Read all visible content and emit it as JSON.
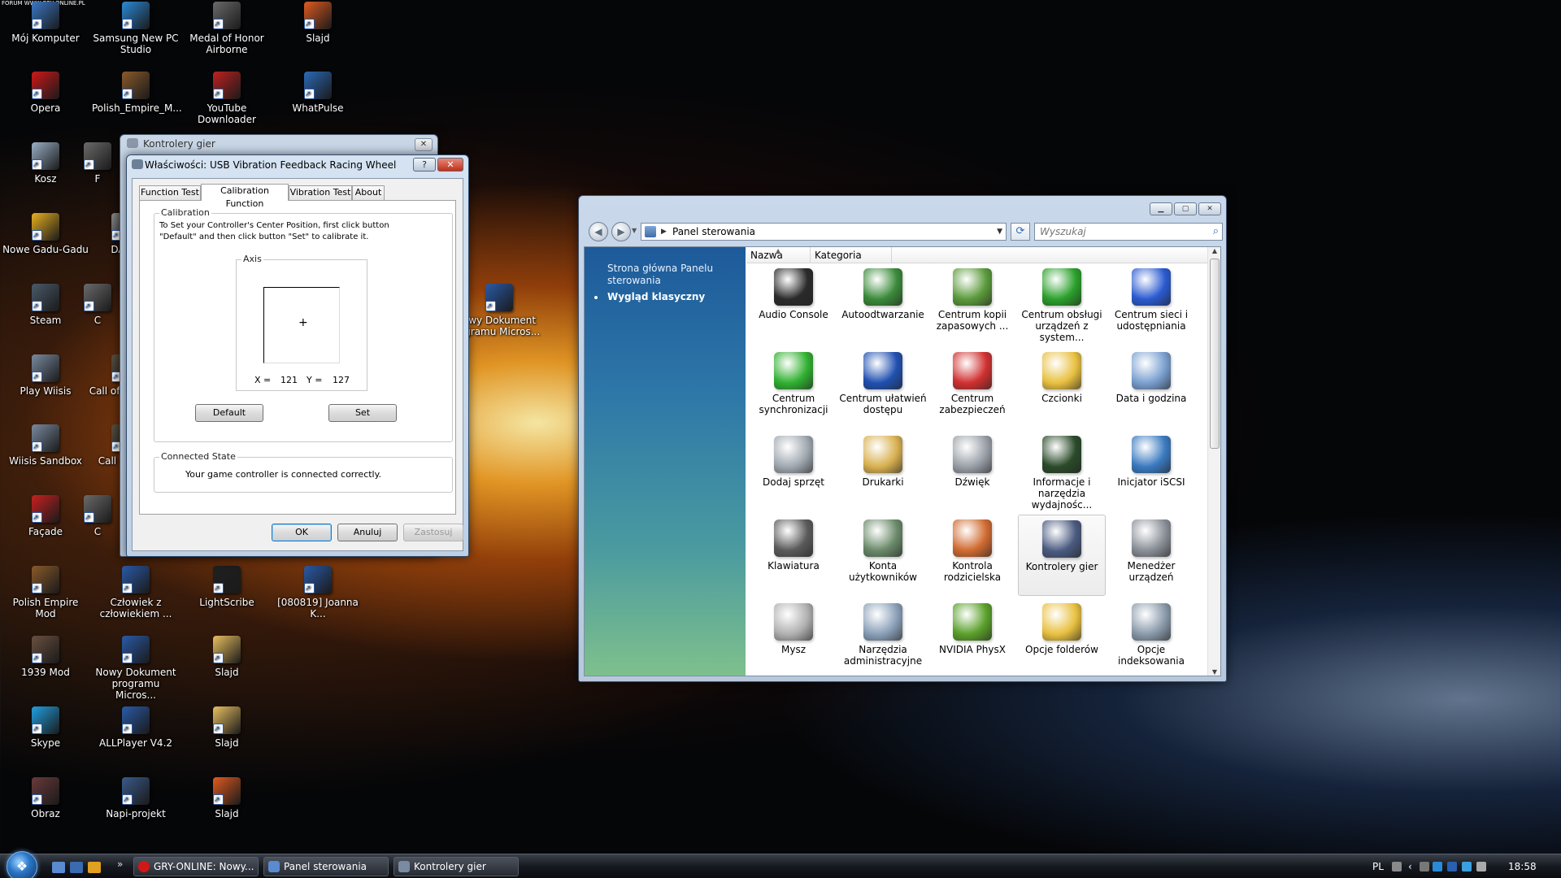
{
  "watermark": "FORUM WWW.GRY-ONLINE.PL",
  "desktop_icons": [
    {
      "label": "Mój Komputer",
      "color": "#3a78c8"
    },
    {
      "label": "Samsung New PC Studio",
      "color": "#2a8ad8"
    },
    {
      "label": "Medal of Honor Airborne",
      "color": "#6a6a6a"
    },
    {
      "label": "Slajd",
      "color": "#e05a20"
    },
    {
      "label": "Opera",
      "color": "#d01818"
    },
    {
      "label": "Polish_Empire_M...",
      "color": "#8a5a2a"
    },
    {
      "label": "YouTube Downloader",
      "color": "#c02020"
    },
    {
      "label": "WhatPulse",
      "color": "#2a6ab8"
    },
    {
      "label": "Kosz",
      "color": "#9ab0c8"
    },
    {
      "label": "Nowe Gadu-Gadu",
      "color": "#e8b020"
    },
    {
      "label": "DAEM",
      "color": "#888888"
    },
    {
      "label": "Steam",
      "color": "#4a5a6a"
    },
    {
      "label": "Play Wiisis",
      "color": "#7a8aa0"
    },
    {
      "label": "Call of Warfare",
      "color": "#5a5040"
    },
    {
      "label": "Wiisis Sandbox",
      "color": "#7a8aa0"
    },
    {
      "label": "Call of D W",
      "color": "#5a5040"
    },
    {
      "label": "Façade",
      "color": "#c82020"
    },
    {
      "label": "Polish Empire Mod",
      "color": "#8a5a2a"
    },
    {
      "label": "Człowiek z człowiekiem ...",
      "color": "#2a5aa8"
    },
    {
      "label": "LightScribe",
      "color": "#202020"
    },
    {
      "label": "[080819] Joanna K...",
      "color": "#2a5aa8"
    },
    {
      "label": "1939 Mod",
      "color": "#6a5040"
    },
    {
      "label": "Nowy Dokument programu Micros...",
      "color": "#2a5aa8"
    },
    {
      "label": "Slajd",
      "color": "#e8c060"
    },
    {
      "label": "Skype",
      "color": "#20a0e0"
    },
    {
      "label": "ALLPlayer V4.2",
      "color": "#2a5aa8"
    },
    {
      "label": "Slajd",
      "color": "#e8c060"
    },
    {
      "label": "Obraz",
      "color": "#6a3a3a"
    },
    {
      "label": "Napi-projekt",
      "color": "#3a5a8a"
    },
    {
      "label": "Slajd",
      "color": "#e05a20"
    },
    {
      "label": "owy Dokument ogramu Micros...",
      "color": "#2a5aa8"
    },
    {
      "label": "C",
      "color": "#6a6a6a"
    },
    {
      "label": "C",
      "color": "#6a6a6a"
    },
    {
      "label": "F",
      "color": "#6a6a6a"
    }
  ],
  "kontrolery_window": {
    "title": "Kontrolery gier",
    "close": "✕"
  },
  "props_dialog": {
    "title": "Właściwości: USB Vibration Feedback Racing Wheel",
    "help": "?",
    "close": "✕",
    "tabs": [
      "Function Test",
      "Calibration Function",
      "Vibration Test",
      "About"
    ],
    "calibration_legend": "Calibration",
    "calibration_text": "To Set your Controller's  Center Position, first click button \"Default\" and then click button \"Set\" to calibrate it.",
    "axis_legend": "Axis",
    "crosshair": "+",
    "x_label": "X =",
    "x_value": "121",
    "y_label": "Y =",
    "y_value": "127",
    "default_button": "Default",
    "set_button": "Set",
    "connected_legend": "Connected State",
    "connected_text": "Your game controller is connected correctly.",
    "ok_button": "OK",
    "cancel_button": "Anuluj",
    "apply_button": "Zastosuj"
  },
  "control_panel": {
    "address": "Panel sterowania",
    "search_placeholder": "Wyszukaj",
    "sidebar": {
      "home_link": "Strona główna Panelu sterowania",
      "classic_view": "Wygląd klasyczny"
    },
    "columns": [
      "Nazwa",
      "Kategoria"
    ],
    "items": [
      {
        "label": "Audio Console",
        "color": "#2a2a2a"
      },
      {
        "label": "Autoodtwarzanie",
        "color": "#3a8a3a"
      },
      {
        "label": "Centrum kopii zapasowych ...",
        "color": "#5a9a3a"
      },
      {
        "label": "Centrum obsługi urządzeń z system...",
        "color": "#2aa02a"
      },
      {
        "label": "Centrum sieci i udostępniania",
        "color": "#2a5ad0"
      },
      {
        "label": "Centrum synchronizacji",
        "color": "#30b030"
      },
      {
        "label": "Centrum ułatwień dostępu",
        "color": "#2050b0"
      },
      {
        "label": "Centrum zabezpieczeń",
        "color": "#d03030"
      },
      {
        "label": "Czcionki",
        "color": "#e8c040"
      },
      {
        "label": "Data i godzina",
        "color": "#7aa0d0"
      },
      {
        "label": "Dodaj sprzęt",
        "color": "#a0a8b0"
      },
      {
        "label": "Drukarki",
        "color": "#d8b050"
      },
      {
        "label": "Dźwięk",
        "color": "#9aa0a8"
      },
      {
        "label": "Informacje i narzędzia wydajnośc...",
        "color": "#2a4a2a"
      },
      {
        "label": "Inicjator iSCSI",
        "color": "#3a7ac0"
      },
      {
        "label": "Klawiatura",
        "color": "#5a5a5a"
      },
      {
        "label": "Konta użytkowników",
        "color": "#6a8a6a"
      },
      {
        "label": "Kontrola rodzicielska",
        "color": "#d06a30"
      },
      {
        "label": "Kontrolery gier",
        "color": "#4a5a80"
      },
      {
        "label": "Menedżer urządzeń",
        "color": "#8a9098"
      },
      {
        "label": "Mysz",
        "color": "#b0b0b0"
      },
      {
        "label": "Narzędzia administracyjne",
        "color": "#8aa0b8"
      },
      {
        "label": "NVIDIA PhysX",
        "color": "#5aa02a"
      },
      {
        "label": "Opcje folderów",
        "color": "#e8c040"
      },
      {
        "label": "Opcje indeksowania",
        "color": "#8a9aaa"
      }
    ]
  },
  "taskbar": {
    "more": "»",
    "tasks": [
      "GRY-ONLINE: Nowy...",
      "Panel sterowania",
      "Kontrolery gier"
    ],
    "language": "PL",
    "time": "18:58"
  }
}
